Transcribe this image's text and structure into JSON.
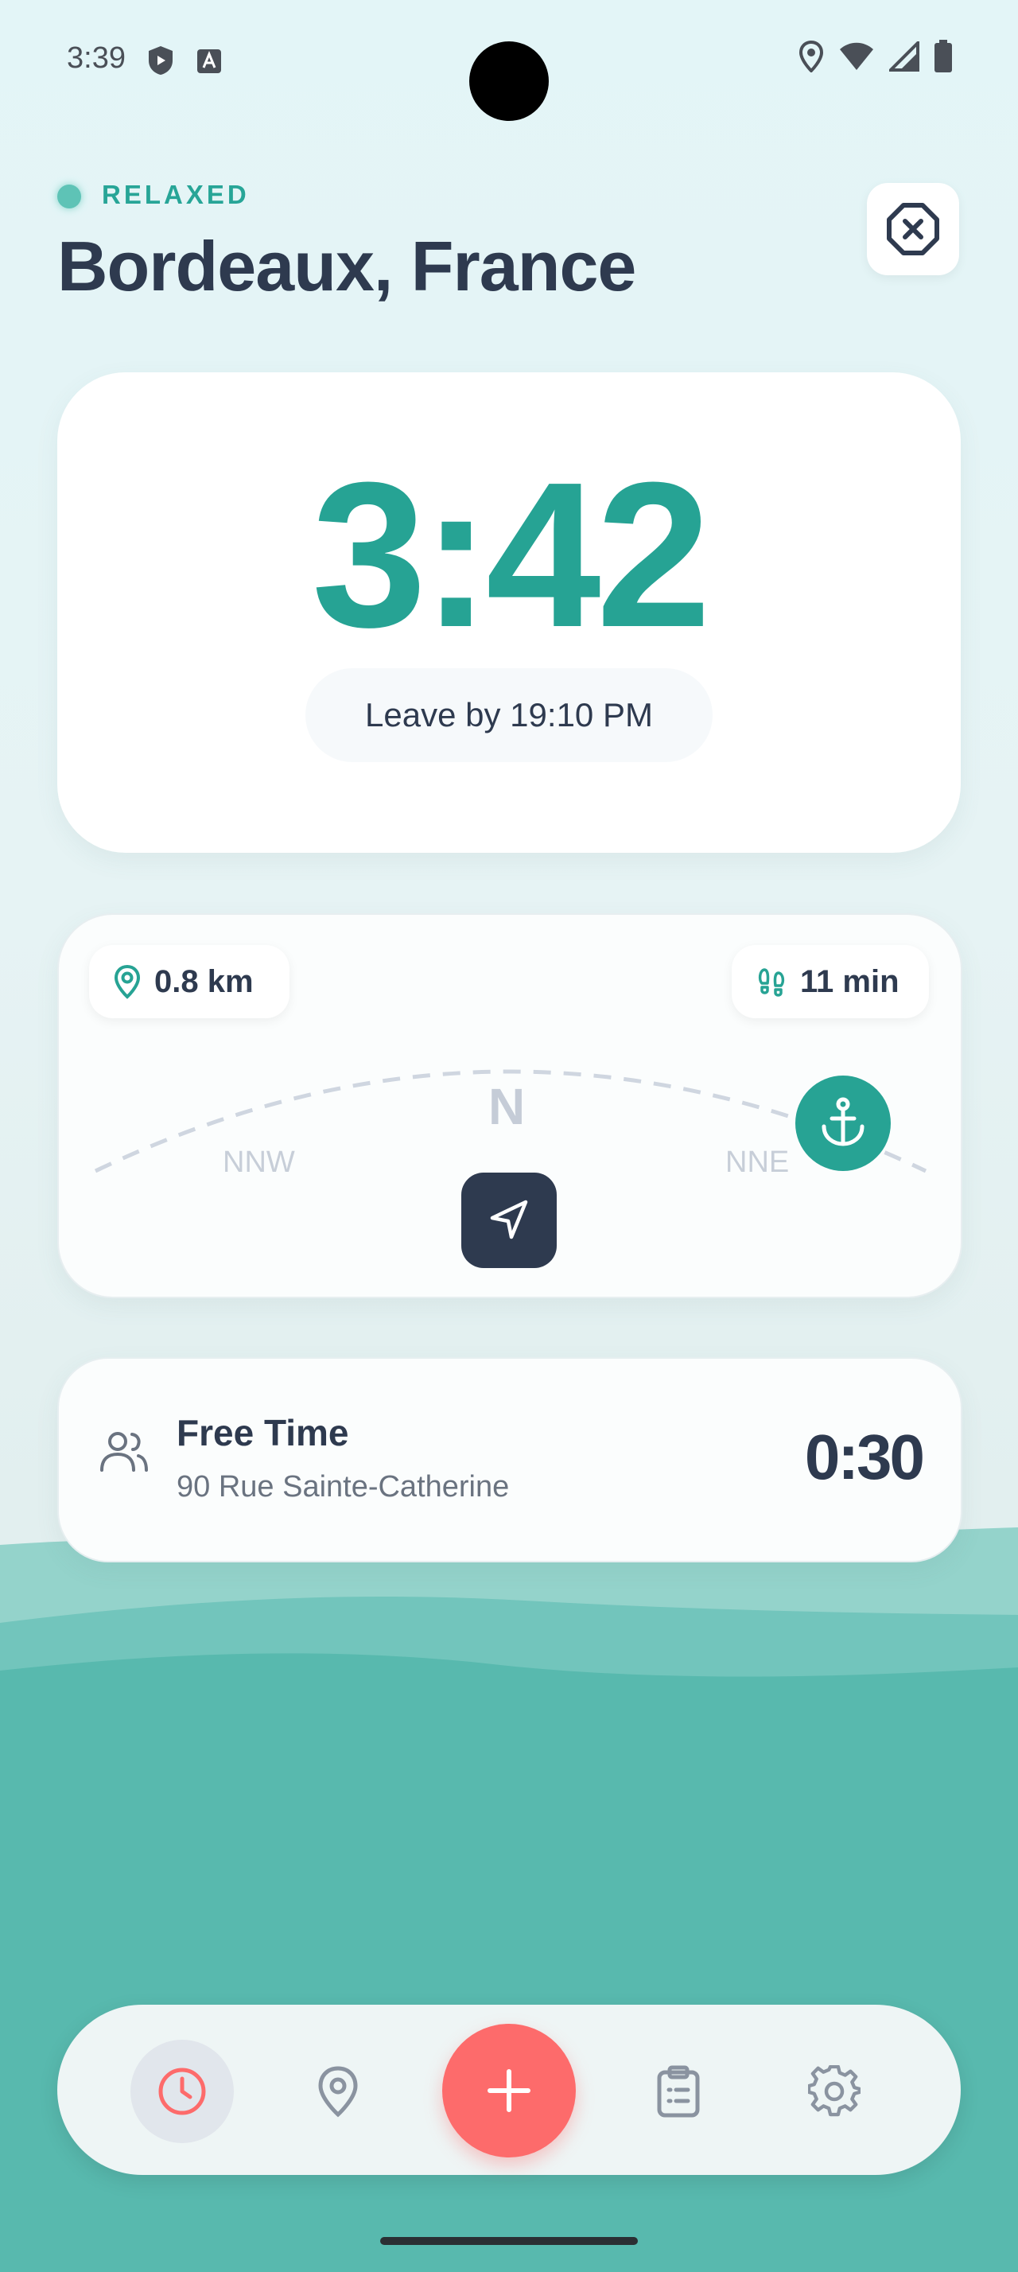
{
  "status_bar": {
    "time": "3:39",
    "icons": [
      "shield-icon",
      "font-icon",
      "location-icon",
      "wifi-icon",
      "signal-icon",
      "battery-icon"
    ]
  },
  "header": {
    "mood": "RELAXED",
    "city": "Bordeaux, France",
    "close_icon": "close-circle-icon"
  },
  "timer_card": {
    "time_remaining": "3:42",
    "leave_by": "Leave by 19:10 PM"
  },
  "compass": {
    "distance": "0.8 km",
    "walk_time": "11 min",
    "directions": {
      "center": "N",
      "left": "NNW",
      "right": "NNE"
    },
    "anchor_icon": "anchor-icon",
    "navigate_icon": "navigation-arrow-icon"
  },
  "next_stop": {
    "title": "Free Time",
    "address": "90 Rue Sainte-Catherine",
    "duration": "0:30",
    "icon": "group-icon"
  },
  "bottom_nav": {
    "items": [
      {
        "name": "clock-icon",
        "active": true
      },
      {
        "name": "location-pin-icon",
        "active": false
      },
      {
        "name": "add-icon",
        "primary": true
      },
      {
        "name": "clipboard-icon",
        "active": false
      },
      {
        "name": "settings-icon",
        "active": false
      }
    ]
  },
  "colors": {
    "accent": "#27a394",
    "fab": "#fd6b6b",
    "dark": "#2e3a4f",
    "wave_top": "#94d3cb",
    "wave_bottom": "#58b9ae"
  }
}
